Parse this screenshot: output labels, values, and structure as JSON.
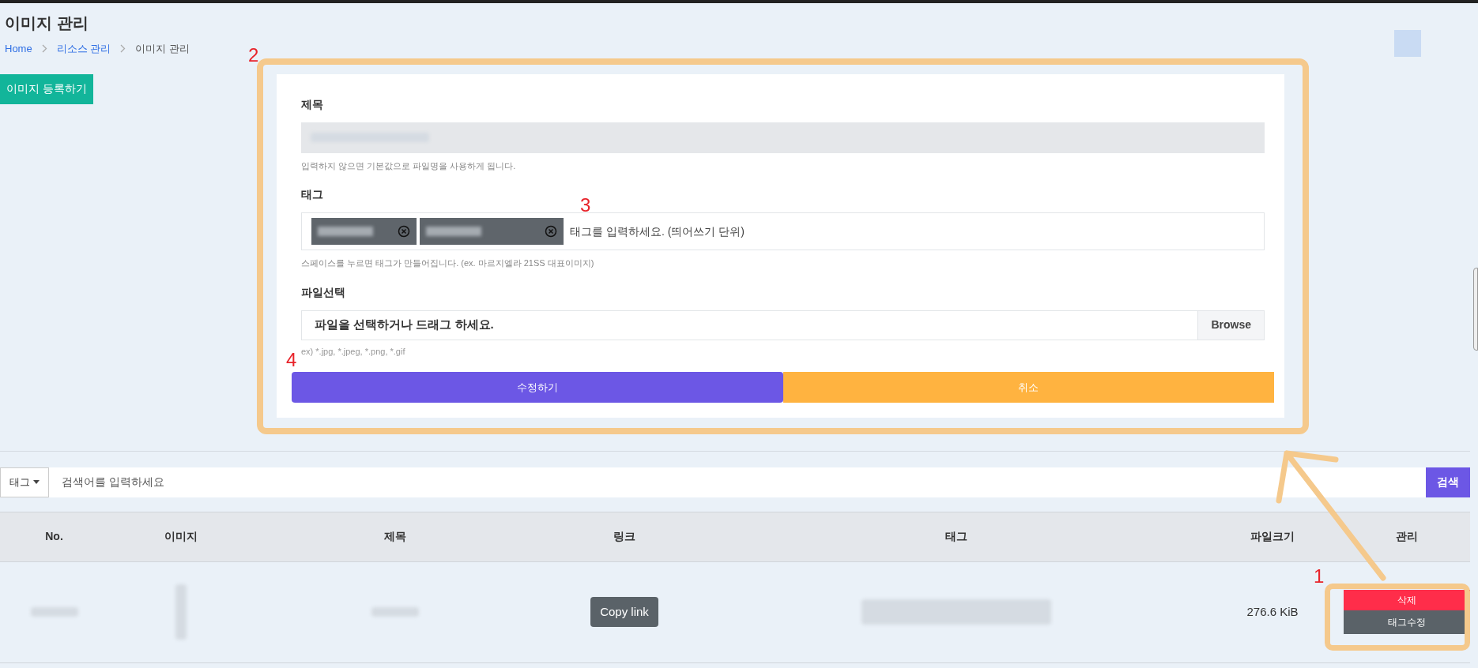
{
  "page": {
    "title": "이미지 관리"
  },
  "breadcrumb": [
    {
      "label": "Home",
      "link": true
    },
    {
      "label": "리소스 관리",
      "link": true
    },
    {
      "label": "이미지 관리",
      "link": false
    }
  ],
  "register_button": "이미지 등록하기",
  "form": {
    "title_field": {
      "label": "제목",
      "redacted": true,
      "hint": "입력하지 않으면 기본값으로 파일명을 사용하게 됩니다."
    },
    "tag_field": {
      "label": "태그",
      "tags": [
        {
          "kind": "blurred"
        },
        {
          "kind": "blurred"
        }
      ],
      "placeholder": "태그를 입력하세요. (띄어쓰기 단위)",
      "hint": "스페이스를 누르면 태그가 만들어집니다. (ex. 마르지엘라 21SS 대표이미지)"
    },
    "file_field": {
      "label": "파일선택",
      "placeholder": "파일을 선택하거나 드래그 하세요.",
      "button": "Browse",
      "hint": "ex) *.jpg, *.jpeg, *.png, *.gif"
    },
    "actions": [
      {
        "kind": "primary",
        "label": "수정하기"
      },
      {
        "kind": "cancel",
        "label": "취소"
      }
    ]
  },
  "search": {
    "filter": "태그",
    "placeholder": "검색어를 입력하세요",
    "button": "검색"
  },
  "table": {
    "columns": [
      "No.",
      "이미지",
      "제목",
      "링크",
      "태그",
      "파일크기",
      "관리"
    ],
    "rows": [
      {
        "cells": [
          {
            "kind": "blurred"
          },
          {
            "kind": "blurred_image"
          },
          {
            "kind": "blurred"
          },
          {
            "kind": "button",
            "text": "Copy link"
          },
          {
            "kind": "blurred_wide"
          },
          {
            "kind": "text",
            "text": "276.6 KiB"
          },
          {
            "kind": "actions",
            "buttons": [
              {
                "kind": "danger",
                "text": "삭제"
              },
              {
                "kind": "secondary",
                "text": "태그수정"
              }
            ]
          }
        ]
      }
    ]
  },
  "annotations": [
    {
      "label": "1"
    },
    {
      "label": "2"
    },
    {
      "label": "3"
    },
    {
      "label": "4"
    }
  ]
}
